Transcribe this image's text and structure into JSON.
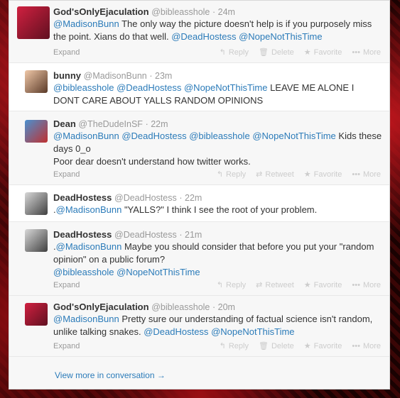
{
  "tweets": [
    {
      "name": "God'sOnlyEjaculation",
      "handle": "@bibleasshole",
      "time": "· 24m",
      "parts": [
        [
          "link",
          "@MadisonBunn"
        ],
        [
          "text",
          " The only way the picture doesn't help is if you purposely miss the point. Xians do that well. "
        ],
        [
          "link",
          "@DeadHostess"
        ],
        [
          "text",
          " "
        ],
        [
          "link",
          "@NopeNotThisTime"
        ]
      ],
      "expand": "Expand",
      "actions": [
        "Reply",
        "Delete",
        "Favorite",
        "More"
      ]
    },
    {
      "name": "bunny",
      "handle": "@MadisonBunn",
      "time": "· 23m",
      "parts": [
        [
          "link",
          "@bibleasshole"
        ],
        [
          "text",
          " "
        ],
        [
          "link",
          "@DeadHostess"
        ],
        [
          "text",
          " "
        ],
        [
          "link",
          "@NopeNotThisTime"
        ],
        [
          "text",
          " LEAVE ME ALONE I DONT CARE ABOUT YALLS RANDOM OPINIONS"
        ]
      ],
      "expand": "",
      "actions": []
    },
    {
      "name": "Dean",
      "handle": "@TheDudeInSF",
      "time": "· 22m",
      "parts": [
        [
          "link",
          "@MadisonBunn"
        ],
        [
          "text",
          " "
        ],
        [
          "link",
          "@DeadHostess"
        ],
        [
          "text",
          " "
        ],
        [
          "link",
          "@bibleasshole"
        ],
        [
          "text",
          " "
        ],
        [
          "link",
          "@NopeNotThisTime"
        ],
        [
          "text",
          " Kids these days 0_o"
        ],
        [
          "br",
          ""
        ],
        [
          "text",
          "Poor dear doesn't understand how twitter works."
        ]
      ],
      "expand": "Expand",
      "actions": [
        "Reply",
        "Retweet",
        "Favorite",
        "More"
      ]
    },
    {
      "name": "DeadHostess",
      "handle": "@DeadHostess",
      "time": "· 22m",
      "parts": [
        [
          "text",
          "."
        ],
        [
          "link",
          "@MadisonBunn"
        ],
        [
          "text",
          " \"YALLS?\" I think I see the root of your problem."
        ]
      ],
      "expand": "",
      "actions": []
    },
    {
      "name": "DeadHostess",
      "handle": "@DeadHostess",
      "time": "· 21m",
      "parts": [
        [
          "text",
          "."
        ],
        [
          "link",
          "@MadisonBunn"
        ],
        [
          "text",
          " Maybe you should consider that before you put your \"random opinion\" on a public forum?"
        ],
        [
          "br",
          ""
        ],
        [
          "link",
          "@bibleasshole"
        ],
        [
          "text",
          " "
        ],
        [
          "link",
          "@NopeNotThisTime"
        ]
      ],
      "expand": "Expand",
      "actions": [
        "Reply",
        "Retweet",
        "Favorite",
        "More"
      ]
    },
    {
      "name": "God'sOnlyEjaculation",
      "handle": "@bibleasshole",
      "time": "· 20m",
      "parts": [
        [
          "link",
          "@MadisonBunn"
        ],
        [
          "text",
          " Pretty sure our understanding of factual science isn't random, unlike talking snakes. "
        ],
        [
          "link",
          "@DeadHostess"
        ],
        [
          "text",
          " "
        ],
        [
          "link",
          "@NopeNotThisTime"
        ]
      ],
      "expand": "Expand",
      "actions": [
        "Reply",
        "Delete",
        "Favorite",
        "More"
      ]
    }
  ],
  "view_more": "View more in conversation →",
  "icons": {
    "Reply": "↰",
    "Delete": "🗑",
    "Retweet": "⇄",
    "Favorite": "★",
    "More": "•••"
  }
}
